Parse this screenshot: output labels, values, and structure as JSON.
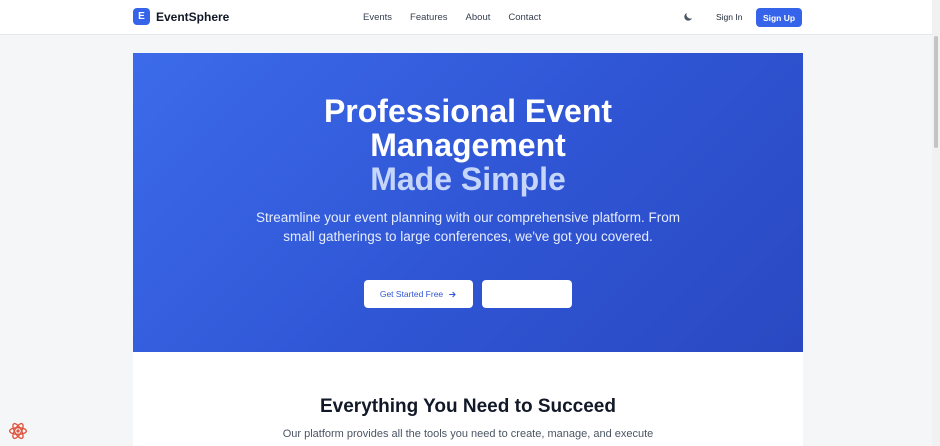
{
  "navbar": {
    "logo_letter": "E",
    "brand": "EventSphere",
    "links": [
      "Events",
      "Features",
      "About",
      "Contact"
    ],
    "theme_toggle_icon": "moon-icon",
    "signin_label": "Sign In",
    "signup_label": "Sign Up"
  },
  "hero": {
    "title_line1": "Professional Event",
    "title_line2": "Management",
    "title_accent": "Made Simple",
    "subtitle": "Streamline your event planning with our comprehensive platform. From small gatherings to large conferences, we've got you covered.",
    "primary_button": "Get Started Free",
    "primary_button_icon": "arrow-right-icon",
    "secondary_button": ""
  },
  "features": {
    "title": "Everything You Need to Succeed",
    "subtitle": "Our platform provides all the tools you need to create, manage, and execute"
  },
  "devtools": {
    "icon": "react-icon"
  },
  "colors": {
    "brand": "#3563e9",
    "hero_start": "#3c6bea",
    "hero_end": "#2a48c2",
    "accent_text": "#c5d6fa"
  }
}
